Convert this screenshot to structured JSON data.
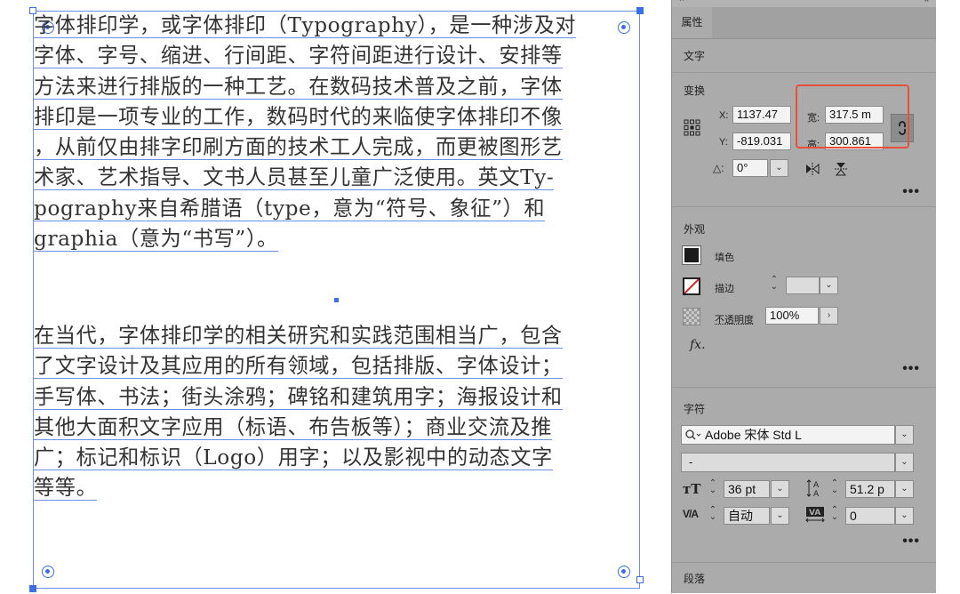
{
  "canvas": {
    "paragraph1": [
      "字体排印学，或字体排印（Typography），是一种涉及对",
      "字体、字号、缩进、行间距、字符间距进行设计、安排等",
      "方法来进行排版的一种工艺。在数码技术普及之前，字体",
      "排印是一项专业的工作，数码时代的来临使字体排印不像",
      "，从前仅由排字印刷方面的技术工人完成，而更被图形艺",
      "术家、艺术指导、文书人员甚至儿童广泛使用。英文Ty-",
      "pography来自希腊语（type，意为“符号、象征”）和",
      "graphia（意为“书写”）。"
    ],
    "paragraph2": [
      "在当代，字体排印学的相关研究和实践范围相当广，包含",
      "了文字设计及其应用的所有领域，包括排版、字体设计；",
      "手写体、书法；街头涂鸦；碑铭和建筑用字；海报设计和",
      "其他大面积文字应用（标语、布告板等）；商业交流及推",
      "广；标记和标识（Logo）用字；以及影视中的动态文字",
      "等等。"
    ]
  },
  "panel": {
    "close_glyph": "×",
    "collapse_glyph": "«",
    "tab_properties": "属性",
    "section_text": "文字",
    "section_transform": "变换",
    "transform": {
      "x_label": "X:",
      "x_value": "1137.47",
      "y_label": "Y:",
      "y_value": "-819.031",
      "w_label": "宽:",
      "w_value": "317.5 m",
      "h_label": "高:",
      "h_value": "300.861",
      "angle_label": "△:",
      "angle_value": "0°"
    },
    "section_appearance": "外观",
    "appearance": {
      "fill_label": "填色",
      "stroke_label": "描边",
      "opacity_label": "不透明度",
      "opacity_value": "100%",
      "fx_label": "fx."
    },
    "section_character": "字符",
    "character": {
      "font_family": "Adobe 宋体 Std L",
      "font_style": "-",
      "font_size": "36 pt",
      "leading": "51.2 p",
      "kerning": "自动",
      "tracking": "0"
    },
    "section_paragraph": "段落",
    "more_glyph": "•••"
  },
  "colors": {
    "selection": "#3b6fe8",
    "highlight_box": "#e8503a",
    "panel_bg": "#ababab",
    "fill_swatch": "#1a1a1a"
  }
}
